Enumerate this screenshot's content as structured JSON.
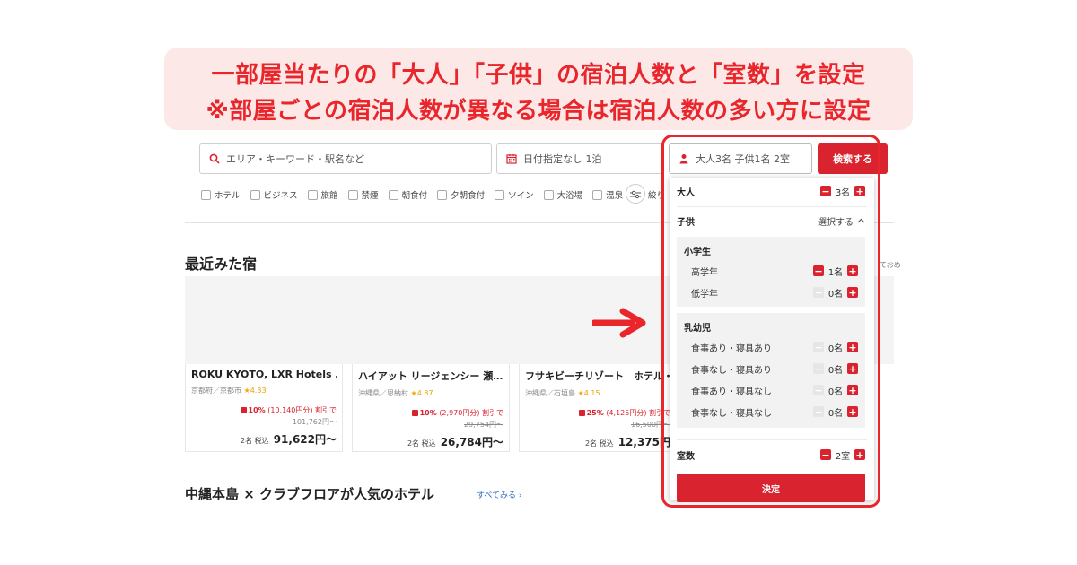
{
  "banner": {
    "line1": "一部屋当たりの「大人」「子供」の宿泊人数と「室数」を設定",
    "line2": "※部屋ごとの宿泊人数が異なる場合は宿泊人数の多い方に設定"
  },
  "search": {
    "area_placeholder": "エリア・キーワード・駅名など",
    "date_value": "日付指定なし 1泊",
    "guest_value": "大人3名 子供1名 2室",
    "button_label": "検索する"
  },
  "filters": [
    {
      "label": "ホテル"
    },
    {
      "label": "ビジネス"
    },
    {
      "label": "旅館"
    },
    {
      "label": "禁煙"
    },
    {
      "label": "朝食付"
    },
    {
      "label": "夕朝食付"
    },
    {
      "label": "ツイン"
    },
    {
      "label": "大浴場"
    },
    {
      "label": "温泉"
    }
  ],
  "filter_more_label": "絞り",
  "recent": {
    "title": "最近みた宿",
    "edge_text": "ておめ",
    "hotels": [
      {
        "name": "ROKU KYOTO, LXR Hotels …",
        "location": "京都府／京都市",
        "rating": "4.33",
        "discount_pct": "10%",
        "discount_text": "(10,140円分) 割引で",
        "original_price": "101,762円～",
        "guests": "2名 税込",
        "price": "91,622円～"
      },
      {
        "name": "ハイアット リージェンシー 瀬…",
        "location": "沖縄県／恩納村",
        "rating": "4.37",
        "discount_pct": "10%",
        "discount_text": "(2,970円分) 割引で",
        "original_price": "29,754円～",
        "guests": "2名 税込",
        "price": "26,784円～"
      },
      {
        "name": "フサキビーチリゾート　ホテル・",
        "location": "沖縄県／石垣島",
        "rating": "4.15",
        "discount_pct": "25%",
        "discount_text": "(4,125円分) 割引で",
        "original_price": "16,500円～",
        "guests": "2名 税込",
        "price": "12,375円"
      }
    ]
  },
  "section2": {
    "title": "中縄本島 × クラブフロアが人気のホテル",
    "see_all": "すべてみる ›"
  },
  "guest_panel": {
    "adult": {
      "label": "大人",
      "value": "3名"
    },
    "child": {
      "label": "子供",
      "toggle": "選択する"
    },
    "elementary": {
      "title": "小学生",
      "rows": [
        {
          "label": "高学年",
          "value": "1名"
        },
        {
          "label": "低学年",
          "value": "0名"
        }
      ]
    },
    "infant": {
      "title": "乳幼児",
      "rows": [
        {
          "label": "食事あり・寝具あり",
          "value": "0名"
        },
        {
          "label": "食事なし・寝具あり",
          "value": "0名"
        },
        {
          "label": "食事あり・寝具なし",
          "value": "0名"
        },
        {
          "label": "食事なし・寝具なし",
          "value": "0名"
        }
      ]
    },
    "rooms": {
      "label": "室数",
      "value": "2室"
    },
    "confirm_label": "決定"
  },
  "colors": {
    "accent": "#d9232f",
    "highlight": "#e8262b",
    "banner_bg": "#fde8e8"
  }
}
